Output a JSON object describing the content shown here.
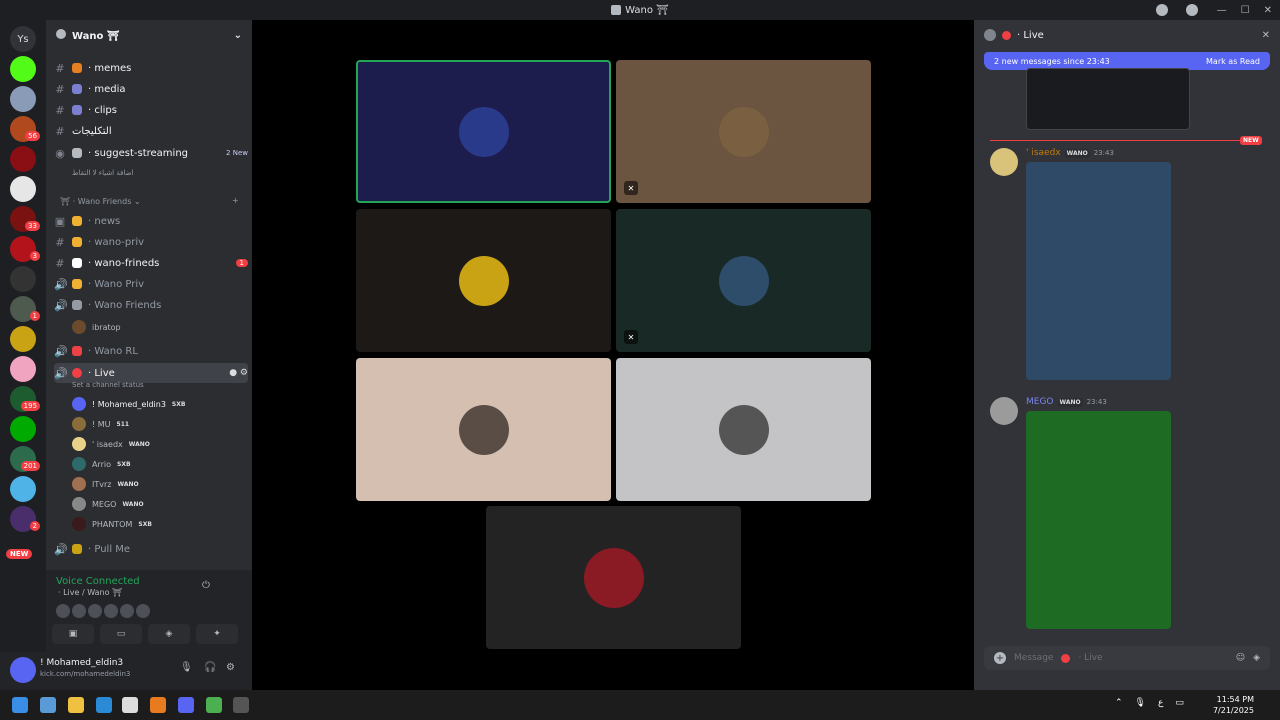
{
  "window": {
    "title": "Wano ⛩"
  },
  "rail": {
    "top_label": "Ys",
    "badges": [
      "56",
      "33",
      "3",
      "1",
      "195",
      "201",
      "2"
    ],
    "new_label": "NEW"
  },
  "sidebar": {
    "guild_name": "Wano ⛩",
    "channels": [
      {
        "name": "· memes"
      },
      {
        "name": "· media"
      },
      {
        "name": "· clips"
      },
      {
        "name": "التكليجات"
      },
      {
        "name": "· suggest-streaming",
        "badge": "2 New"
      }
    ],
    "suggest_sub": "اضافة اشياء لا التقاط",
    "category": "Wano Friends",
    "friends_channels": [
      {
        "name": "· news"
      },
      {
        "name": "· wano-priv"
      },
      {
        "name": "· wano-frineds",
        "badge": "1"
      },
      {
        "name": "· Wano Priv"
      },
      {
        "name": "· Wano Friends"
      }
    ],
    "ibratop_user": "ibratop",
    "wano_rl": "· Wano RL",
    "live_channel": "· Live",
    "live_status": "Set a channel status",
    "voice_users": [
      {
        "name": "! Mohamed_eldin3",
        "tag": "SXB"
      },
      {
        "name": "! MU",
        "tag": "511"
      },
      {
        "name": "' isaedx",
        "tag": "WANO"
      },
      {
        "name": "Arrio",
        "tag": "SXB"
      },
      {
        "name": "ITvrz",
        "tag": "WANO"
      },
      {
        "name": "MEGO",
        "tag": "WANO"
      },
      {
        "name": "PHANTOM",
        "tag": "SXB"
      }
    ],
    "pull_me": "· Pull Me"
  },
  "voice": {
    "status": "Voice Connected",
    "location": "· Live / Wano ⛩"
  },
  "user_panel": {
    "name": "! Mohamed_eldin3",
    "status": "kick.com/mohamedeldin3"
  },
  "chat": {
    "header": "· Live",
    "new_messages": "2 new messages since 23:43",
    "mark_read": "Mark as Read",
    "new_tag": "NEW",
    "messages": [
      {
        "author": "' isaedx",
        "tag": "WANO",
        "time": "23:43",
        "color": "#c27c0e"
      },
      {
        "author": "MEGO",
        "tag": "WANO",
        "time": "23:43",
        "color": "#5865f2"
      }
    ],
    "input_placeholder": "Message",
    "input_channel": "· Live"
  },
  "taskbar": {
    "time": "11:54 PM",
    "date": "7/21/2025",
    "lang": "ع"
  }
}
